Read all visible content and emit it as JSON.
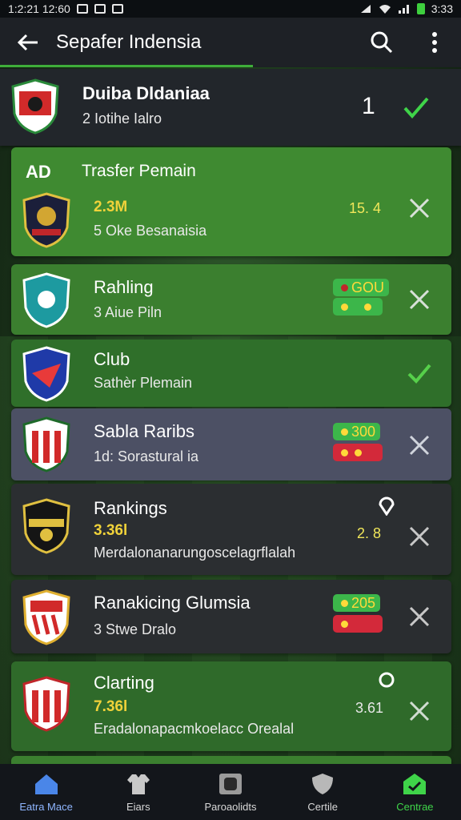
{
  "status": {
    "time_left": "1:2:21 12:60",
    "time_right": "3:33"
  },
  "appbar": {
    "title": "Sepafer Indensia"
  },
  "rows": [
    {
      "name": "Duiba Dldaniaa",
      "sub": "2 Iotihe Ialro",
      "num": "1"
    },
    {
      "badge": "AD",
      "name": "Trasfer Pemain",
      "price": "2.3M",
      "sub": "5 Oke Besanaisia",
      "num": "15. 4"
    },
    {
      "name": "Rahling",
      "sub": "3 Aiue Piln",
      "pill_text": "GOU"
    },
    {
      "name": "Club",
      "sub": "Sathèr Plemain"
    },
    {
      "name": "Sabla Raribs",
      "sub": "1d: Sorastural ia",
      "pill_text": "300"
    },
    {
      "name": "Rankings",
      "price": "3.36l",
      "sub": "Merdalonanarungoscelagrflalah",
      "num": "2. 8"
    },
    {
      "name": "Ranakicing Glumsia",
      "sub": "3 Stwe Dralo",
      "pill_text": "205"
    },
    {
      "name": "Clarting",
      "price": "7.36l",
      "sub": "Eradalonapacmkoelacc Orealal",
      "num": "3.61"
    }
  ],
  "nav": [
    {
      "label": "Eatra Mace",
      "icon": "home-icon"
    },
    {
      "label": "Eiars",
      "icon": "shirt-icon"
    },
    {
      "label": "Paroaolidts",
      "icon": "tv-icon"
    },
    {
      "label": "Certile",
      "icon": "shield-icon"
    },
    {
      "label": "Centrae",
      "icon": "storefront-icon"
    }
  ],
  "colors": {
    "accent": "#3fae3a",
    "active_nav": "#3fd449",
    "price": "#f0d23a"
  }
}
